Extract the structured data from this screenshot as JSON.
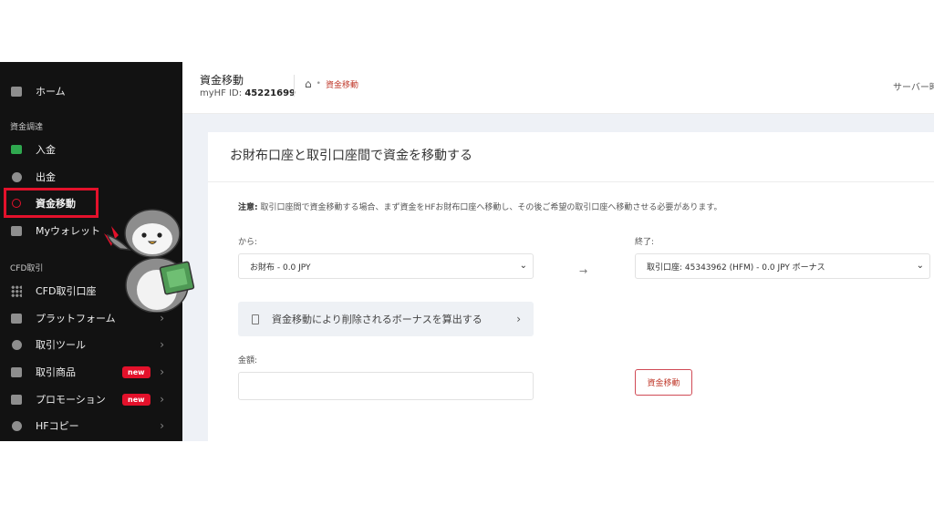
{
  "sidebar": {
    "items": [
      {
        "label": "ホーム"
      },
      {
        "label": "入金"
      },
      {
        "label": "出金"
      },
      {
        "label": "資金移動"
      },
      {
        "label": "Myウォレット"
      },
      {
        "label": "CFD取引口座"
      },
      {
        "label": "プラットフォーム"
      },
      {
        "label": "取引ツール"
      },
      {
        "label": "取引商品",
        "badge": "new"
      },
      {
        "label": "プロモーション",
        "badge": "new"
      },
      {
        "label": "HFコピー"
      }
    ],
    "sections": {
      "funding": "資金調達",
      "cfd": "CFD取引"
    }
  },
  "header": {
    "title": "資金移動",
    "account_label": "myHF ID:",
    "account_id": "45221699",
    "breadcrumb_current": "資金移動",
    "server_label": "サーバー時"
  },
  "main": {
    "card_title": "お財布口座と取引口座間で資金を移動する",
    "notice_label": "注意:",
    "notice_text": "取引口座間で資金移動する場合、まず資金をHFお財布口座へ移動し、その後ご希望の取引口座へ移動させる必要があります。",
    "from_label": "から:",
    "from_value": "お財布 - 0.0 JPY",
    "to_label": "終了:",
    "to_value": "取引口座: 45343962 (HFM) - 0.0 JPY ボーナス",
    "arrow": "→",
    "bonus_calc_label": "資金移動により削除されるボーナスを算出する",
    "amount_label": "金額:",
    "amount_value": "",
    "submit_label": "資金移動"
  },
  "colors": {
    "accent": "#e3112b",
    "sidebar_bg": "#121212",
    "main_bg": "#eef1f6"
  },
  "icons": {
    "home": "chart-bar-icon",
    "deposit": "money-icon",
    "withdraw": "coins-icon",
    "transfer": "transfer-circle-icon",
    "wallet": "wallet-icon",
    "cfd": "grid-icon",
    "platform": "chart-line-icon",
    "tools": "tools-icon",
    "products": "list-icon",
    "promotion": "gift-icon",
    "copy": "user-icon"
  }
}
